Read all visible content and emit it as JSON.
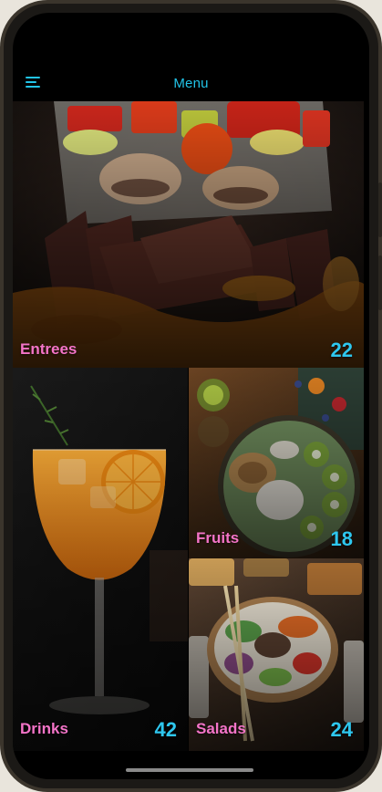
{
  "header": {
    "title": "Menu",
    "menu_icon": "hamburger-icon"
  },
  "categories": [
    {
      "label": "Entrees",
      "count": "22"
    },
    {
      "label": "Drinks",
      "count": "42"
    },
    {
      "label": "Fruits",
      "count": "18"
    },
    {
      "label": "Salads",
      "count": "24"
    }
  ],
  "colors": {
    "accent": "#22c4e8",
    "label": "#f474c8",
    "count": "#2ec7ef",
    "background": "#000000"
  }
}
